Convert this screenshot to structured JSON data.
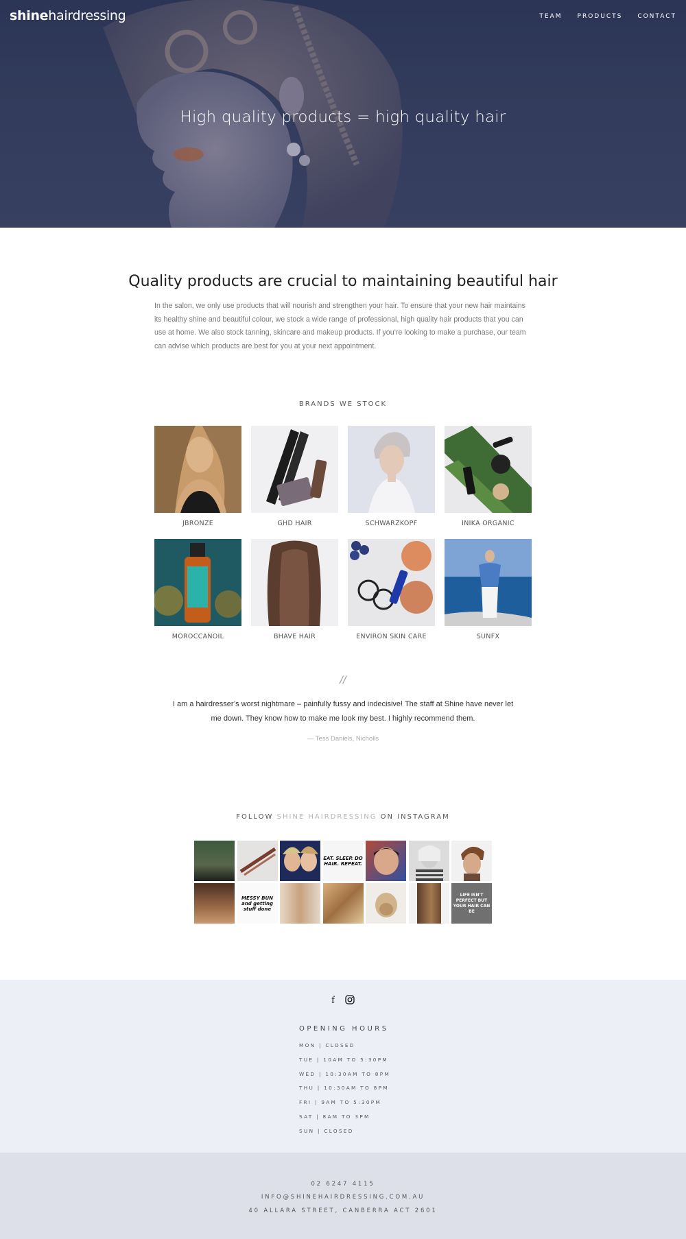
{
  "header": {
    "logo_bold": "shine",
    "logo_light": "hairdressing",
    "nav": [
      "TEAM",
      "PRODUCTS",
      "CONTACT"
    ]
  },
  "hero": {
    "title": "High quality products = high quality hair"
  },
  "intro": {
    "title": "Quality products are crucial to maintaining beautiful hair",
    "text": "In the salon, we only use products that will nourish and strengthen your hair. To ensure that your new hair maintains its healthy shine and beautiful colour, we stock a wide range of professional, high quality hair products that you can use at home. We also stock tanning, skincare and makeup products. If you’re looking to make a purchase, our team can advise which products are best for you at your next appointment."
  },
  "brands": {
    "heading": "BRANDS WE STOCK",
    "items": [
      {
        "name": "JBRONZE"
      },
      {
        "name": "GHD HAIR"
      },
      {
        "name": "SCHWARZKOPF"
      },
      {
        "name": "INIKA ORGANIC"
      },
      {
        "name": "MOROCCANOIL"
      },
      {
        "name": "BHAVE HAIR"
      },
      {
        "name": "ENVIRON SKIN CARE"
      },
      {
        "name": "SUNFX"
      }
    ]
  },
  "testimonial": {
    "mark": "//",
    "text": "I am a hairdresser’s worst nightmare – painfully fussy and indecisive! The staff at Shine have never let me down. They know how to make me look my best. I highly recommend them.",
    "author": "— Tess Daniels, Nicholls"
  },
  "instagram": {
    "heading_prefix": "FOLLOW ",
    "heading_accent": "SHINE HAIRDRESSING",
    "heading_suffix": " ON INSTAGRAM",
    "tile_texts": {
      "t3": "EAT. SLEEP. DO HAIR. REPEAT.",
      "t8": "MESSY BUN and getting stuff done",
      "t13": "LIFE ISN'T PERFECT BUT YOUR HAIR CAN BE"
    }
  },
  "footer": {
    "social_icons": [
      "facebook-icon",
      "instagram-icon"
    ],
    "hours_title": "OPENING HOURS",
    "hours": [
      "MON | CLOSED",
      "TUE  |  10AM TO 5:30PM",
      "WED  |  10:30AM TO 8PM",
      "THU  |  10:30AM TO 8PM",
      "FRI  |  9AM TO 5:30PM",
      "SAT  |  8AM TO 3PM",
      "SUN  |  CLOSED"
    ],
    "phone": "02 6247 4115",
    "email": "INFO@SHINEHAIRDRESSING.COM.AU",
    "address": "40 ALLARA STREET, CANBERRA ACT 2601"
  },
  "colors": {
    "hero_overlay": "#2c3656",
    "footer_hours_bg": "#eceff6",
    "footer_contact_bg": "#dde0e8",
    "accent_gray": "#b5b5b5"
  }
}
